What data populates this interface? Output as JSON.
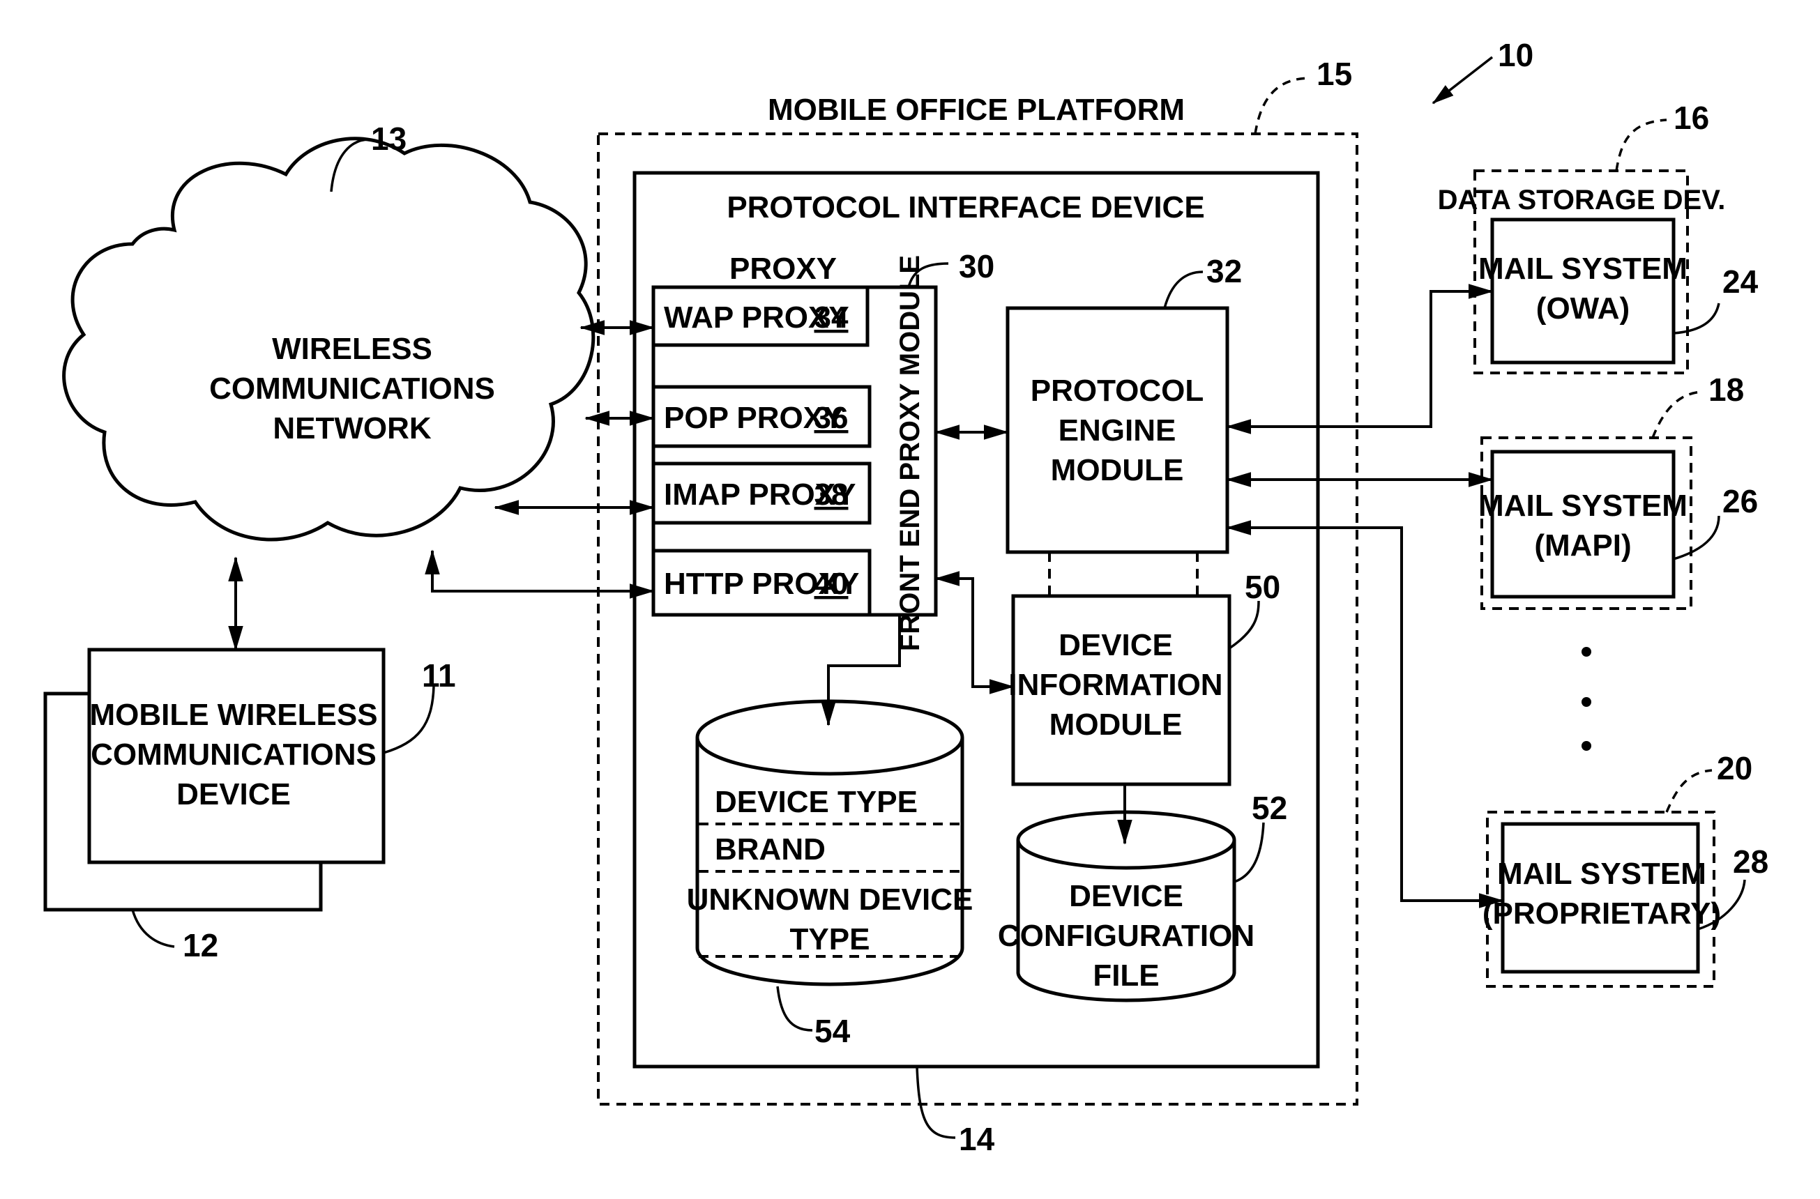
{
  "figure": {
    "reference": "10",
    "platform": {
      "label": "MOBILE OFFICE PLATFORM",
      "ref": "15"
    },
    "protocol_interface": {
      "label": "PROTOCOL INTERFACE DEVICE",
      "ref": "14"
    },
    "network": {
      "lines": [
        "WIRELESS",
        "COMMUNICATIONS",
        "NETWORK"
      ],
      "ref": "13"
    },
    "mobile_device": {
      "lines": [
        "MOBILE WIRELESS",
        "COMMUNICATIONS",
        "DEVICE"
      ],
      "ref": "11",
      "stack_ref": "12"
    },
    "proxy": {
      "heading": "PROXY",
      "module_label": "FRONT END PROXY MODULE",
      "module_ref": "30",
      "items": [
        {
          "label": "WAP PROXY",
          "ref": "34"
        },
        {
          "label": "POP PROXY",
          "ref": "36"
        },
        {
          "label": "IMAP PROXY",
          "ref": "38"
        },
        {
          "label": "HTTP PROXY",
          "ref": "40"
        }
      ]
    },
    "protocol_engine": {
      "lines": [
        "PROTOCOL",
        "ENGINE",
        "MODULE"
      ],
      "ref": "32"
    },
    "device_info": {
      "lines": [
        "DEVICE",
        "INFORMATION",
        "MODULE"
      ],
      "ref": "50"
    },
    "device_db": {
      "rows": [
        "DEVICE TYPE",
        "BRAND",
        "UNKNOWN DEVICE",
        "TYPE"
      ],
      "ref": "54"
    },
    "config_file": {
      "lines": [
        "DEVICE",
        "CONFIGURATION",
        "FILE"
      ],
      "ref": "52"
    },
    "data_storage": {
      "label": "DATA STORAGE DEV.",
      "ref": "16"
    },
    "mail_systems": [
      {
        "lines": [
          "MAIL SYSTEM",
          "(OWA)"
        ],
        "ref": "24",
        "container_ref": "16"
      },
      {
        "lines": [
          "MAIL SYSTEM",
          "(MAPI)"
        ],
        "ref": "26",
        "container_ref": "18"
      },
      {
        "lines": [
          "MAIL SYSTEM",
          "(PROPRIETARY)"
        ],
        "ref": "28",
        "container_ref": "20"
      }
    ]
  }
}
